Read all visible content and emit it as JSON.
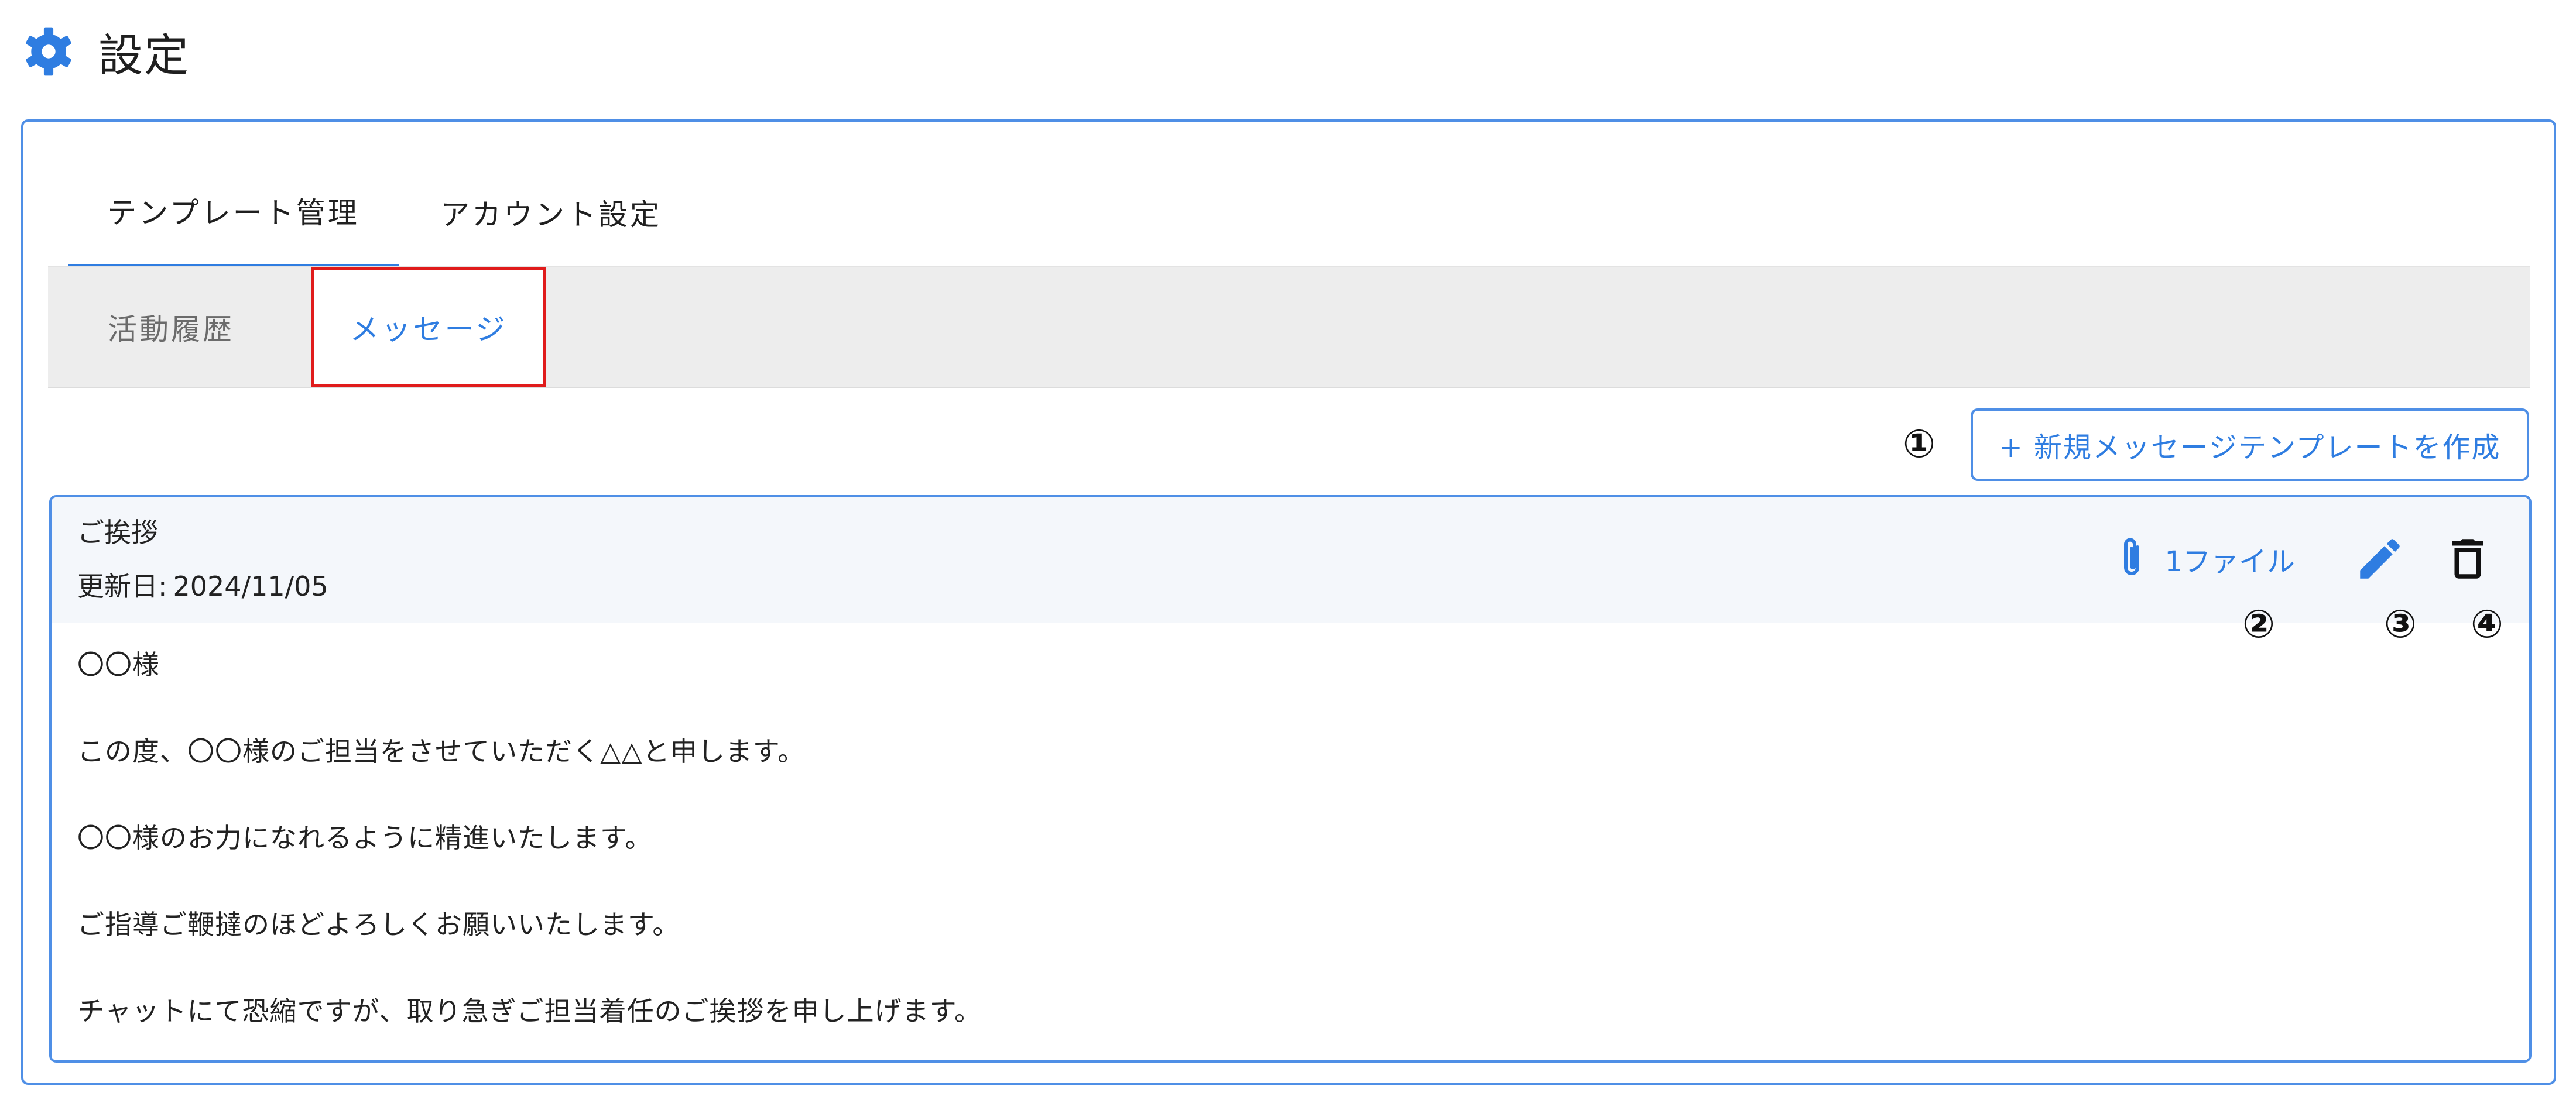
{
  "header": {
    "title": "設定",
    "icon": "gear-icon"
  },
  "tabs": [
    {
      "label": "テンプレート管理",
      "active": true
    },
    {
      "label": "アカウント設定",
      "active": false
    }
  ],
  "subtabs": [
    {
      "label": "活動履歴",
      "active": false
    },
    {
      "label": "メッセージ",
      "active": true
    }
  ],
  "toolbar": {
    "create_label": "+ 新規メッセージテンプレートを作成"
  },
  "markers": [
    "①",
    "②",
    "③",
    "④"
  ],
  "template": {
    "title": "ご挨拶",
    "updated_label": "更新日:",
    "updated_value": "2024/11/05",
    "attachment_label": "1ファイル",
    "body": [
      "〇〇様",
      "この度、〇〇様のご担当をさせていただく△△と申します。",
      "〇〇様のお力になれるように精進いたします。",
      "ご指導ご鞭撻のほどよろしくお願いいたします。",
      "チャットにて恐縮ですが、取り急ぎご担当着任のご挨拶を申し上げます。"
    ]
  },
  "colors": {
    "accent": "#2f7de1",
    "border": "#4f8fe6",
    "highlight": "#e01b1b",
    "subbar": "#ededed"
  }
}
